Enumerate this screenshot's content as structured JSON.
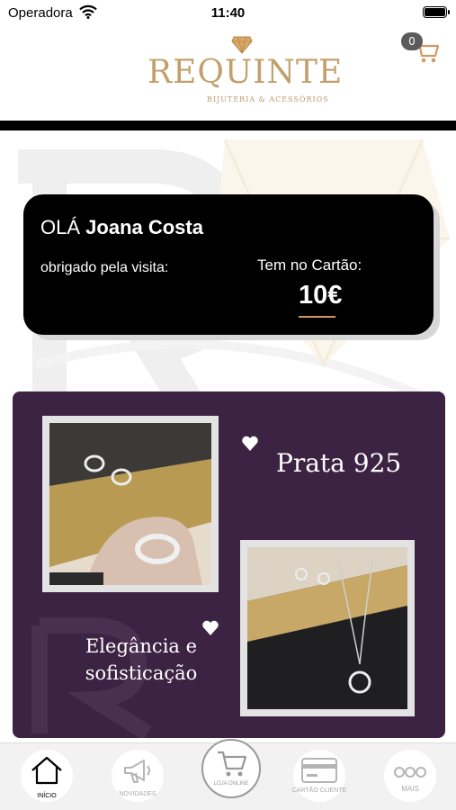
{
  "status_bar": {
    "carrier": "Operadora",
    "time": "11:40"
  },
  "header": {
    "logo_text": "REQUINTE",
    "logo_subtitle": "BIJUTERIA & ACESSÓRIOS",
    "cart_count": "0"
  },
  "greeting_card": {
    "greeting": "OLÁ",
    "user_name": "Joana Costa",
    "thanks": "obrigado pela visita:",
    "balance_label": "Tem no Cartão:",
    "balance_value": "10€"
  },
  "promo": {
    "headline_1": "Prata 925",
    "headline_2_line1": "Elegância e",
    "headline_2_line2": "sofisticação"
  },
  "tabs": [
    {
      "label": "INÍCIO",
      "icon": "home-icon",
      "active": true
    },
    {
      "label": "NOVIDADES",
      "icon": "megaphone-icon",
      "active": false
    },
    {
      "label": "LOJA ONLINE",
      "icon": "cart-icon",
      "active": false
    },
    {
      "label": "CARTÃO CLIENTE",
      "icon": "card-icon",
      "active": false
    },
    {
      "label": "MAIS",
      "icon": "more-icon",
      "active": false
    }
  ],
  "colors": {
    "accent_gold": "#c2a06c",
    "promo_purple": "#3d2343",
    "underline_orange": "#d5965a"
  }
}
